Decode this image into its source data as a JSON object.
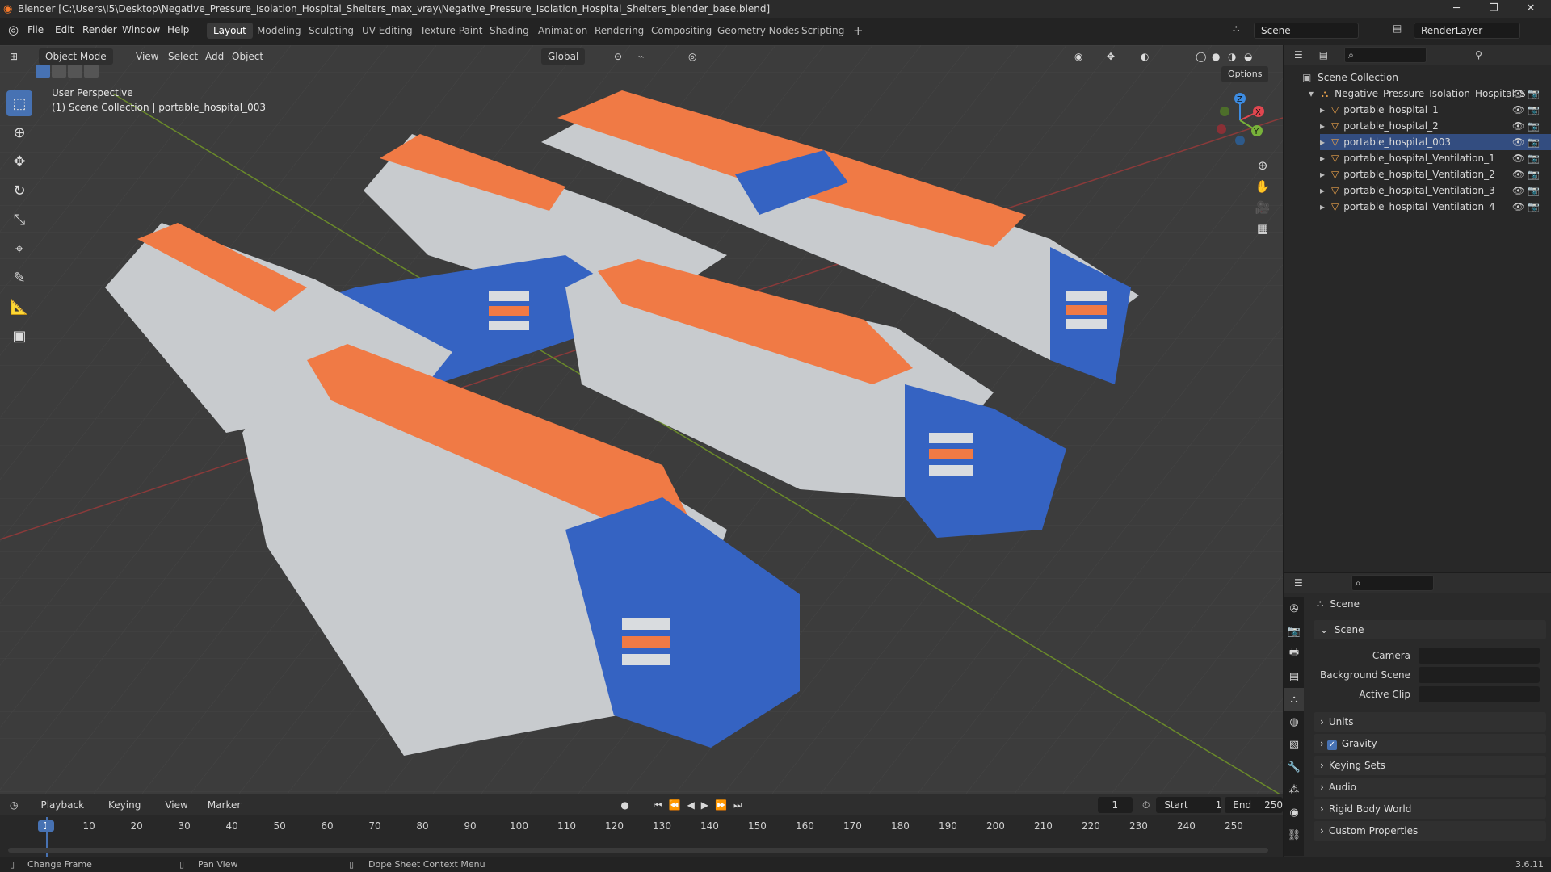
{
  "title_bar": {
    "title": "Blender [C:\\Users\\I5\\Desktop\\Negative_Pressure_Isolation_Hospital_Shelters_max_vray\\Negative_Pressure_Isolation_Hospital_Shelters_blender_base.blend]",
    "minimize": "─",
    "maximize": "❐",
    "close": "✕"
  },
  "menus": [
    "File",
    "Edit",
    "Render",
    "Window",
    "Help"
  ],
  "workspaces": [
    "Layout",
    "Modeling",
    "Sculpting",
    "UV Editing",
    "Texture Paint",
    "Shading",
    "Animation",
    "Rendering",
    "Compositing",
    "Geometry Nodes",
    "Scripting"
  ],
  "add_workspace": "+",
  "scene_selector": {
    "scene": "Scene",
    "render_layer": "RenderLayer"
  },
  "viewport": {
    "mode": "Object Mode",
    "menus": [
      "View",
      "Select",
      "Add",
      "Object"
    ],
    "orientation": "Global",
    "options": "Options",
    "overlay_title": "User Perspective",
    "overlay_subtitle": "(1) Scene Collection | portable_hospital_003",
    "gizmo": {
      "x": "X",
      "y": "Y",
      "z": "Z"
    },
    "colors": {
      "orange": "#f07a45",
      "white": "#d9dcdf",
      "blue": "#3563c2",
      "grid": "#3d3d3d"
    }
  },
  "outliner": {
    "root": "Scene Collection",
    "collection": "Negative_Pressure_Isolation_Hospital_S",
    "items": [
      "portable_hospital_1",
      "portable_hospital_2",
      "portable_hospital_003",
      "portable_hospital_Ventilation_1",
      "portable_hospital_Ventilation_2",
      "portable_hospital_Ventilation_3",
      "portable_hospital_Ventilation_4"
    ]
  },
  "properties": {
    "header": "Scene",
    "section": "Scene",
    "fields": [
      {
        "label": "Camera"
      },
      {
        "label": "Background Scene"
      },
      {
        "label": "Active Clip"
      }
    ],
    "panels": [
      "Units",
      "Gravity",
      "Keying Sets",
      "Audio",
      "Rigid Body World",
      "Custom Properties"
    ],
    "gravity_checked": true
  },
  "timeline": {
    "menus": [
      "Playback",
      "Keying",
      "View",
      "Marker"
    ],
    "current_frame": "1",
    "start_label": "Start",
    "start": "1",
    "end_label": "End",
    "end": "250",
    "ticks": [
      "1",
      "10",
      "20",
      "30",
      "40",
      "50",
      "60",
      "70",
      "80",
      "90",
      "100",
      "110",
      "120",
      "130",
      "140",
      "150",
      "160",
      "170",
      "180",
      "190",
      "200",
      "210",
      "220",
      "230",
      "240",
      "250"
    ]
  },
  "status_bar": {
    "left": "Change Frame",
    "middle": "Pan View",
    "right": "Dope Sheet Context Menu",
    "version": "3.6.11"
  }
}
